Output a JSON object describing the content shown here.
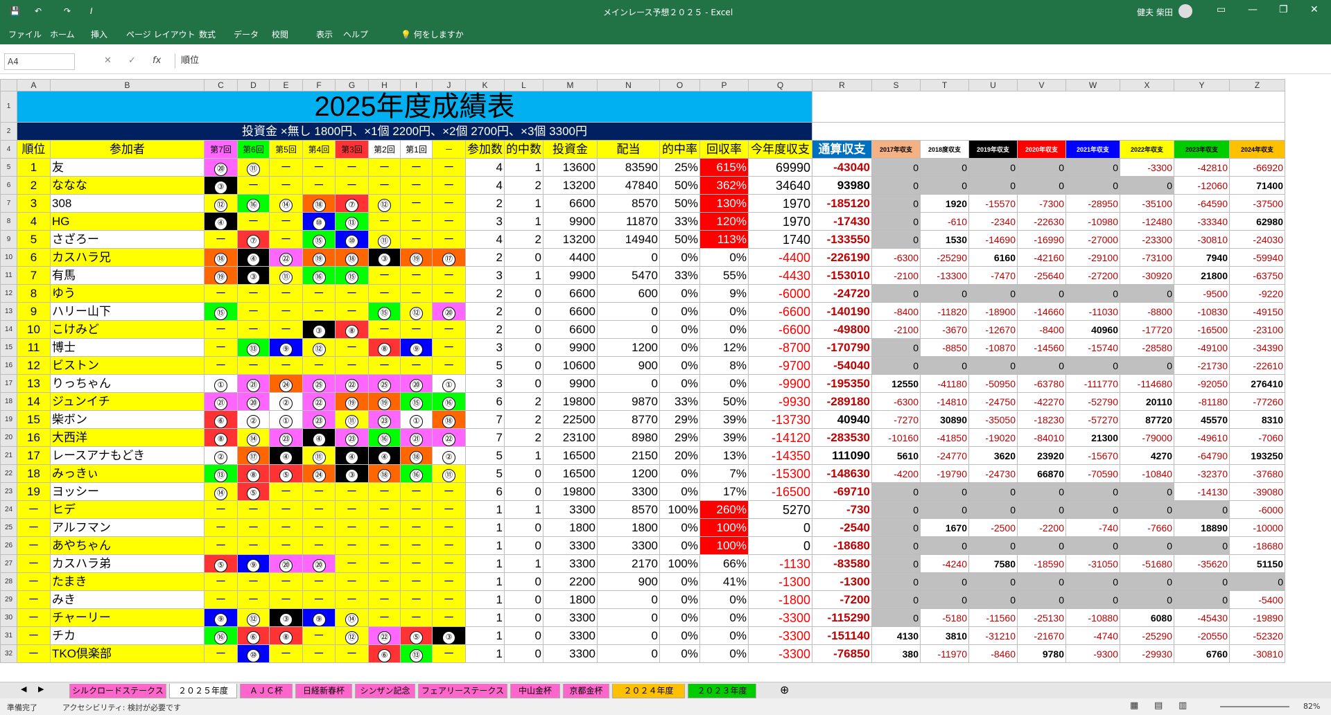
{
  "app": {
    "title": "メインレース予想２０２５ - Excel",
    "user": "健夫 柴田"
  },
  "ribbon_tabs": [
    "ファイル",
    "ホーム",
    "挿入",
    "ページ レイアウト",
    "数式",
    "データ",
    "校閲",
    "表示",
    "ヘルプ"
  ],
  "ribbon_search": "何をしますか",
  "formula": {
    "namebox": "A4",
    "content": "順位"
  },
  "sheet": {
    "title": "2025年度成績表",
    "subtitle": "投資金 ×無し 1800円、×1個 2200円、×2個 2700円、×3個 3300円",
    "col_letters": [
      "A",
      "B",
      "C",
      "D",
      "E",
      "F",
      "G",
      "H",
      "I",
      "J",
      "K",
      "L",
      "M",
      "N",
      "O",
      "P",
      "Q",
      "R",
      "S",
      "T",
      "U",
      "V",
      "W",
      "X",
      "Y",
      "Z"
    ],
    "headers": [
      "順位",
      "参加者",
      "第7回",
      "第6回",
      "第5回",
      "第4回",
      "第3回",
      "第2回",
      "第1回",
      "－",
      "参加数",
      "的中数",
      "投資金",
      "配当",
      "的中率",
      "回収率",
      "今年度収支",
      "通算収支",
      "2017年収支",
      "2018度収支",
      "2019年収支",
      "2020年収支",
      "2021年収支",
      "2022年収支",
      "2023年収支",
      "2024年収支"
    ],
    "rows": [
      [
        "1",
        "友",
        "⑳",
        "⑪",
        "－",
        "－",
        "－",
        "－",
        "－",
        "－",
        "4",
        "1",
        "13600",
        "83590",
        "25%",
        "615%",
        "69990",
        "-43040",
        "0",
        "0",
        "0",
        "0",
        "0",
        "-3300",
        "-42810",
        "-66920"
      ],
      [
        "2",
        "ななな",
        "③",
        "－",
        "－",
        "－",
        "－",
        "－",
        "－",
        "－",
        "4",
        "2",
        "13200",
        "47840",
        "50%",
        "362%",
        "34640",
        "93980",
        "0",
        "0",
        "0",
        "0",
        "0",
        "0",
        "-12060",
        "71400"
      ],
      [
        "3",
        "308",
        "⑫",
        "⑯",
        "⑭",
        "⑱",
        "⑦",
        "⑫",
        "－",
        "－",
        "2",
        "1",
        "6600",
        "8570",
        "50%",
        "130%",
        "1970",
        "-185120",
        "0",
        "1920",
        "-15570",
        "-7300",
        "-28950",
        "-35100",
        "-64590",
        "-37500"
      ],
      [
        "4",
        "HG",
        "④",
        "－",
        "－",
        "⑩",
        "⑬",
        "－",
        "－",
        "－",
        "3",
        "1",
        "9900",
        "11870",
        "33%",
        "120%",
        "1970",
        "-17430",
        "0",
        "-610",
        "-2340",
        "-22630",
        "-10980",
        "-12480",
        "-33340",
        "62980"
      ],
      [
        "5",
        "さざろー",
        "－",
        "⑦",
        "－",
        "⑮",
        "⑩",
        "⑪",
        "－",
        "－",
        "4",
        "2",
        "13200",
        "14940",
        "50%",
        "113%",
        "1740",
        "-133550",
        "0",
        "1530",
        "-14690",
        "-16990",
        "-27000",
        "-23300",
        "-30810",
        "-24030"
      ],
      [
        "6",
        "カスハラ兄",
        "⑱",
        "④",
        "㉒",
        "⑲",
        "⑱",
        "③",
        "⑲",
        "⑰",
        "2",
        "0",
        "4400",
        "0",
        "0%",
        "0%",
        "-4400",
        "-226190",
        "-6300",
        "-25290",
        "6160",
        "-42160",
        "-29100",
        "-73100",
        "7940",
        "-59940"
      ],
      [
        "7",
        "有馬",
        "⑲",
        "③",
        "⑪",
        "⑯",
        "⑮",
        "－",
        "－",
        "－",
        "3",
        "1",
        "9900",
        "5470",
        "33%",
        "55%",
        "-4430",
        "-153010",
        "-2100",
        "-13300",
        "-7470",
        "-25640",
        "-27200",
        "-30920",
        "21800",
        "-63750"
      ],
      [
        "8",
        "ゆう",
        "－",
        "－",
        "－",
        "－",
        "－",
        "－",
        "－",
        "－",
        "2",
        "0",
        "6600",
        "600",
        "0%",
        "9%",
        "-6000",
        "-24720",
        "0",
        "0",
        "0",
        "0",
        "0",
        "0",
        "-9500",
        "-9220"
      ],
      [
        "9",
        "ハリー山下",
        "⑮",
        "－",
        "－",
        "－",
        "－",
        "⑮",
        "⑫",
        "⑳",
        "2",
        "0",
        "6600",
        "0",
        "0%",
        "0%",
        "-6600",
        "-140190",
        "-8400",
        "-11820",
        "-18900",
        "-14660",
        "-11030",
        "-8800",
        "-10830",
        "-49150"
      ],
      [
        "10",
        "こけみど",
        "－",
        "－",
        "－",
        "③",
        "⑧",
        "－",
        "－",
        "－",
        "2",
        "0",
        "6600",
        "0",
        "0%",
        "0%",
        "-6600",
        "-49800",
        "-2100",
        "-3670",
        "-12670",
        "-8400",
        "40960",
        "-17720",
        "-16500",
        "-23100"
      ],
      [
        "11",
        "博士",
        "－",
        "⑬",
        "⑨",
        "⑫",
        "－",
        "⑧",
        "⑨",
        "－",
        "3",
        "0",
        "9900",
        "1200",
        "0%",
        "12%",
        "-8700",
        "-170790",
        "0",
        "-8850",
        "-10870",
        "-14560",
        "-15740",
        "-28580",
        "-49100",
        "-34390"
      ],
      [
        "12",
        "ビストン",
        "－",
        "－",
        "－",
        "－",
        "－",
        "－",
        "－",
        "－",
        "5",
        "0",
        "10600",
        "900",
        "0%",
        "8%",
        "-9700",
        "-54040",
        "0",
        "0",
        "0",
        "0",
        "0",
        "0",
        "-21730",
        "-22610"
      ],
      [
        "13",
        "りっちゃん",
        "①",
        "㉑",
        "㉔",
        "㉕",
        "㉒",
        "㉕",
        "⑳",
        "①",
        "3",
        "0",
        "9900",
        "0",
        "0%",
        "0%",
        "-9900",
        "-195350",
        "12550",
        "-41180",
        "-50950",
        "-63780",
        "-111770",
        "-114680",
        "-92050",
        "276410"
      ],
      [
        "14",
        "ジュンイチ",
        "㉑",
        "⑳",
        "②",
        "㉒",
        "⑲",
        "⑲",
        "⑮",
        "⑯",
        "6",
        "2",
        "19800",
        "9870",
        "33%",
        "50%",
        "-9930",
        "-289180",
        "-6300",
        "-14810",
        "-24750",
        "-42270",
        "-52790",
        "20110",
        "-81180",
        "-77260"
      ],
      [
        "15",
        "柴ボン",
        "⑥",
        "②",
        "①",
        "㉓",
        "⑪",
        "㉓",
        "①",
        "⑱",
        "7",
        "2",
        "22500",
        "8770",
        "29%",
        "39%",
        "-13730",
        "40940",
        "-7270",
        "30890",
        "-35050",
        "-18230",
        "-57270",
        "87720",
        "45570",
        "8310"
      ],
      [
        "16",
        "大西洋",
        "⑧",
        "⑭",
        "㉓",
        "④",
        "㉓",
        "⑯",
        "㉑",
        "㉒",
        "7",
        "2",
        "23100",
        "8980",
        "29%",
        "39%",
        "-14120",
        "-283530",
        "-10160",
        "-41850",
        "-19020",
        "-84010",
        "21300",
        "-79000",
        "-49610",
        "-7060"
      ],
      [
        "17",
        "レースアナもどき",
        "②",
        "⑰",
        "④",
        "⑪",
        "④",
        "④",
        "⑱",
        "②",
        "5",
        "1",
        "16500",
        "2150",
        "20%",
        "13%",
        "-14350",
        "111090",
        "5610",
        "-24770",
        "3620",
        "23920",
        "-15670",
        "4270",
        "-64790",
        "193250"
      ],
      [
        "18",
        "みっきぃ",
        "⑬",
        "⑧",
        "⑤",
        "㉔",
        "③",
        "⑱",
        "⑯",
        "⑪",
        "5",
        "0",
        "16500",
        "1200",
        "0%",
        "7%",
        "-15300",
        "-148630",
        "-4200",
        "-19790",
        "-24730",
        "66870",
        "-70590",
        "-10840",
        "-32370",
        "-37680"
      ],
      [
        "19",
        "ヨッシー",
        "⑭",
        "⑤",
        "－",
        "－",
        "－",
        "－",
        "－",
        "－",
        "6",
        "0",
        "19800",
        "3300",
        "0%",
        "17%",
        "-16500",
        "-69710",
        "0",
        "0",
        "0",
        "0",
        "0",
        "0",
        "-14130",
        "-39080"
      ],
      [
        "－",
        "ヒデ",
        "－",
        "－",
        "－",
        "－",
        "－",
        "－",
        "－",
        "－",
        "1",
        "1",
        "3300",
        "8570",
        "100%",
        "260%",
        "5270",
        "-730",
        "0",
        "0",
        "0",
        "0",
        "0",
        "0",
        "0",
        "-6000"
      ],
      [
        "－",
        "アルフマン",
        "－",
        "－",
        "－",
        "－",
        "－",
        "－",
        "－",
        "－",
        "1",
        "0",
        "1800",
        "1800",
        "0%",
        "100%",
        "0",
        "-2540",
        "0",
        "1670",
        "-2500",
        "-2200",
        "-740",
        "-7660",
        "18890",
        "-10000"
      ],
      [
        "－",
        "あやちゃん",
        "－",
        "－",
        "－",
        "－",
        "－",
        "－",
        "－",
        "－",
        "1",
        "0",
        "3300",
        "3300",
        "0%",
        "100%",
        "0",
        "-18680",
        "0",
        "0",
        "0",
        "0",
        "0",
        "0",
        "0",
        "-18680"
      ],
      [
        "－",
        "カスハラ弟",
        "⑤",
        "⑨",
        "⑳",
        "⑳",
        "－",
        "－",
        "－",
        "－",
        "1",
        "1",
        "3300",
        "2170",
        "100%",
        "66%",
        "-1130",
        "-83580",
        "0",
        "-4240",
        "7580",
        "-18590",
        "-31050",
        "-51680",
        "-35620",
        "51150"
      ],
      [
        "－",
        "たまき",
        "－",
        "－",
        "－",
        "－",
        "－",
        "－",
        "－",
        "－",
        "1",
        "0",
        "2200",
        "900",
        "0%",
        "41%",
        "-1300",
        "-1300",
        "0",
        "0",
        "0",
        "0",
        "0",
        "0",
        "0",
        "0"
      ],
      [
        "－",
        "みき",
        "－",
        "－",
        "－",
        "－",
        "－",
        "－",
        "－",
        "－",
        "1",
        "0",
        "1800",
        "0",
        "0%",
        "0%",
        "-1800",
        "-7200",
        "0",
        "0",
        "0",
        "0",
        "0",
        "0",
        "0",
        "-5400"
      ],
      [
        "－",
        "チャーリー",
        "⑨",
        "⑫",
        "③",
        "⑨",
        "⑭",
        "－",
        "－",
        "－",
        "1",
        "0",
        "3300",
        "0",
        "0%",
        "0%",
        "-3300",
        "-115290",
        "0",
        "-5180",
        "-11560",
        "-25130",
        "-10880",
        "6080",
        "-45430",
        "-19890"
      ],
      [
        "－",
        "チカ",
        "⑯",
        "⑥",
        "⑧",
        "－",
        "⑫",
        "㉒",
        "⑤",
        "③",
        "1",
        "0",
        "3300",
        "0",
        "0%",
        "0%",
        "-3300",
        "-151140",
        "4130",
        "3810",
        "-31210",
        "-21670",
        "-4740",
        "-25290",
        "-20550",
        "-52320"
      ],
      [
        "－",
        "TKO倶楽部",
        "－",
        "⑩",
        "－",
        "－",
        "－",
        "⑥",
        "⑬",
        "－",
        "1",
        "0",
        "3300",
        "0",
        "0%",
        "0%",
        "-3300",
        "-76850",
        "380",
        "-11970",
        "-8460",
        "9780",
        "-9300",
        "-29930",
        "6760",
        "-30810"
      ]
    ]
  },
  "sheet_tabs": [
    "シルクロードステークス",
    "２０２５年度",
    "ＡＪＣ杯",
    "日経新春杯",
    "シンザン記念",
    "フェアリーステークス",
    "中山金杯",
    "京都金杯",
    "２０２４年度",
    "２０２３年度"
  ],
  "status": {
    "ready": "準備完了",
    "accessibility": "アクセシビリティ: 検討が必要です",
    "zoom": "82%"
  }
}
